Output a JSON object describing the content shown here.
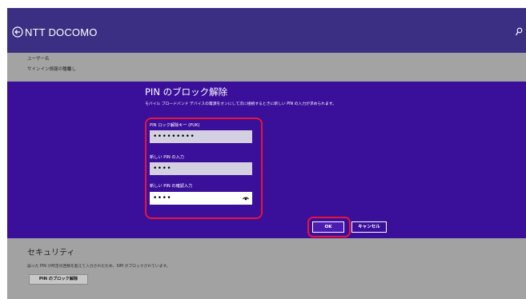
{
  "header": {
    "title": "NTT DOCOMO",
    "back_icon": "back-arrow-circle-icon",
    "search_icon": "search-icon"
  },
  "info": {
    "rows": [
      {
        "label": "ユーザー名",
        "value": ""
      },
      {
        "label": "サインイン情報の種類",
        "value": "なし"
      }
    ]
  },
  "dialog": {
    "title": "PIN のブロック解除",
    "description": "モバイル ブロードバンド デバイスの電源をオンにして次に接続するときに新しい PIN の入力が求められます。",
    "fields": [
      {
        "label": "PIN ロック解除キー (PUK)",
        "value": "•••••••••"
      },
      {
        "label": "新しい PIN の入力",
        "value": "••••"
      },
      {
        "label": "新しい PIN の確認入力",
        "value": "••••"
      }
    ],
    "ok_label": "OK",
    "cancel_label": "キャンセル"
  },
  "security": {
    "title": "セキュリティ",
    "description": "誤った PIN が所定の回数を超えて入力されたため、SIM がブロックされています。",
    "button_label": "PIN のブロック解除"
  },
  "colors": {
    "header": "#3a2f82",
    "dialog": "#3a0f9a",
    "highlight": "#e8143c",
    "background": "#a2a2a2"
  }
}
